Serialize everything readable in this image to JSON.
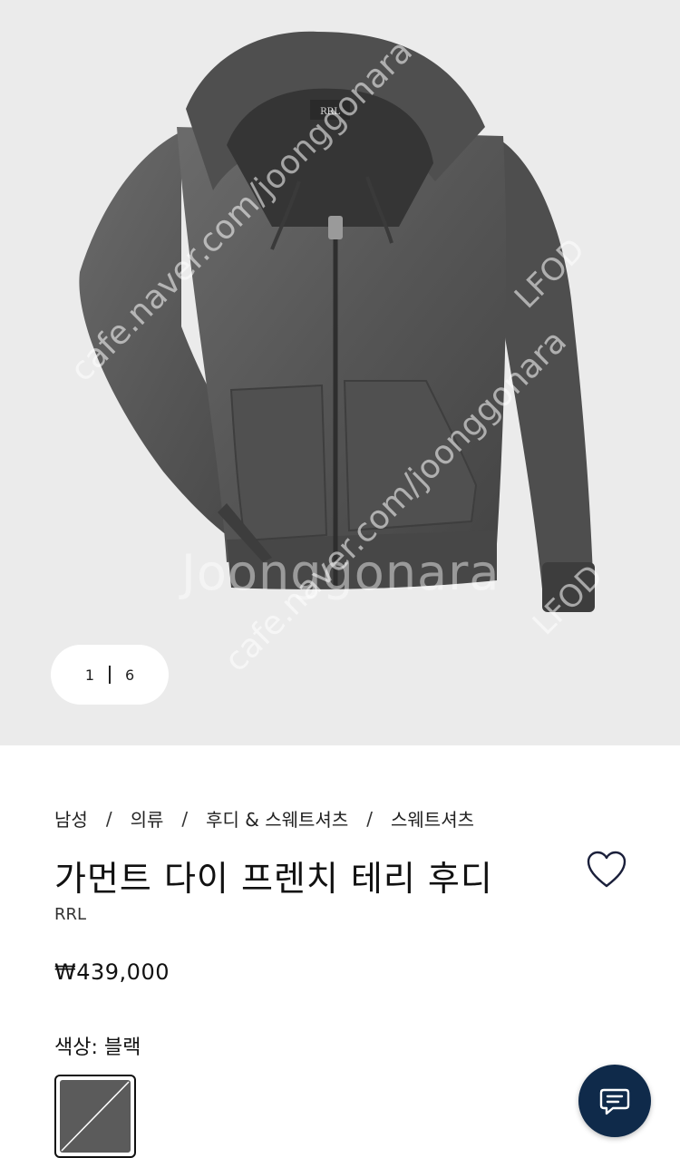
{
  "gallery": {
    "current": "1",
    "total": "6",
    "watermarks": [
      "cafe.naver.com/joonggonara",
      "Joonggonara",
      "LFOD"
    ],
    "image_alt": "charcoal zip hoodie product photo"
  },
  "breadcrumb": [
    "남성",
    "의류",
    "후디 & 스웨트셔츠",
    "스웨트셔츠"
  ],
  "breadcrumb_separator": "/",
  "product": {
    "title": "가먼트 다이 프렌치 테리 후디",
    "brand": "RRL",
    "price": "₩439,000",
    "color_label": "색상: 블랙"
  },
  "icons": {
    "wishlist": "heart-outline-icon",
    "chat": "chat-bubble-icon"
  },
  "colors": {
    "gallery_bg": "#ebebeb",
    "chat_button": "#0f2a4a",
    "swatch": "#5b5b5b"
  }
}
